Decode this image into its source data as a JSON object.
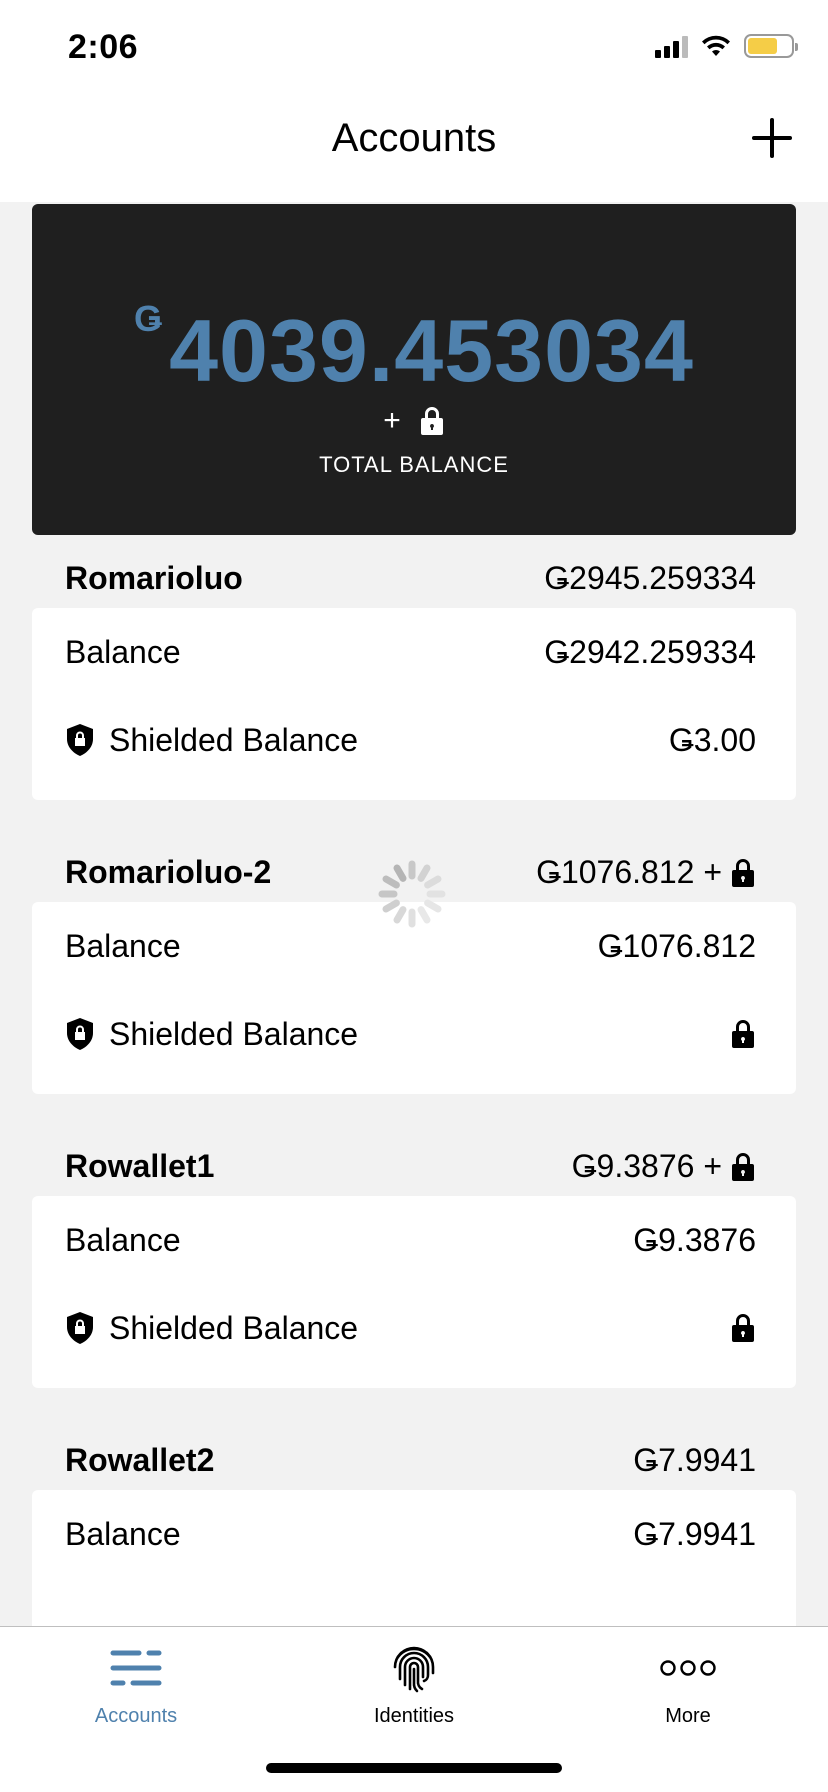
{
  "status_bar": {
    "time": "2:06"
  },
  "header": {
    "title": "Accounts"
  },
  "total": {
    "currency_symbol": "Ǥ",
    "amount": "4039.453034",
    "extras_plus": "+",
    "label": "TOTAL BALANCE"
  },
  "accounts": [
    {
      "name": "Romarioluo",
      "total": "Ǥ2945.259334",
      "balance_label": "Balance",
      "balance": "Ǥ2942.259334",
      "shielded_label": "Shielded Balance",
      "shielded": "Ǥ3.00"
    },
    {
      "name": "Romarioluo-2",
      "total": "Ǥ1076.812 +",
      "balance_label": "Balance",
      "balance": "Ǥ1076.812",
      "shielded_label": "Shielded Balance",
      "shielded": ""
    },
    {
      "name": "Rowallet1",
      "total": "Ǥ9.3876 +",
      "balance_label": "Balance",
      "balance": "Ǥ9.3876",
      "shielded_label": "Shielded Balance",
      "shielded": ""
    },
    {
      "name": "Rowallet2",
      "total": "Ǥ7.9941",
      "balance_label": "Balance",
      "balance": "Ǥ7.9941"
    }
  ],
  "tabs": [
    {
      "label": "Accounts",
      "icon": "list-icon",
      "active": true
    },
    {
      "label": "Identities",
      "icon": "fingerprint-icon",
      "active": false
    },
    {
      "label": "More",
      "icon": "more-icon",
      "active": false
    }
  ],
  "colors": {
    "accent": "#4f81ad",
    "card_dark": "#1f1f1f",
    "background": "#f2f2f2"
  }
}
